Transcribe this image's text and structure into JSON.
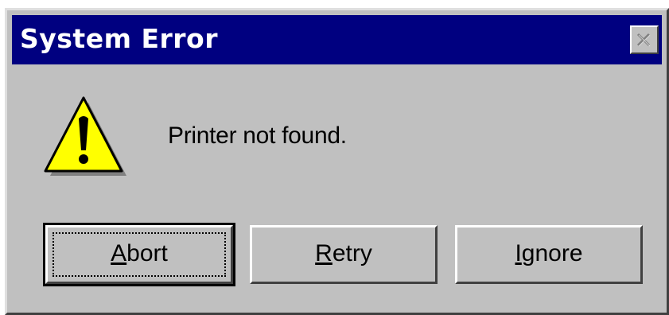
{
  "window": {
    "title": "System Error"
  },
  "dialog": {
    "message": "Printer not found.",
    "icon": "warning-icon"
  },
  "buttons": [
    {
      "accel": "A",
      "rest": "bort",
      "label": "Abort"
    },
    {
      "accel": "R",
      "rest": "etry",
      "label": "Retry"
    },
    {
      "accel": "I",
      "rest": "gnore",
      "label": "Ignore"
    }
  ],
  "colors": {
    "titlebar": "#000080",
    "face": "#c0c0c0",
    "warning": "#ffff00"
  }
}
